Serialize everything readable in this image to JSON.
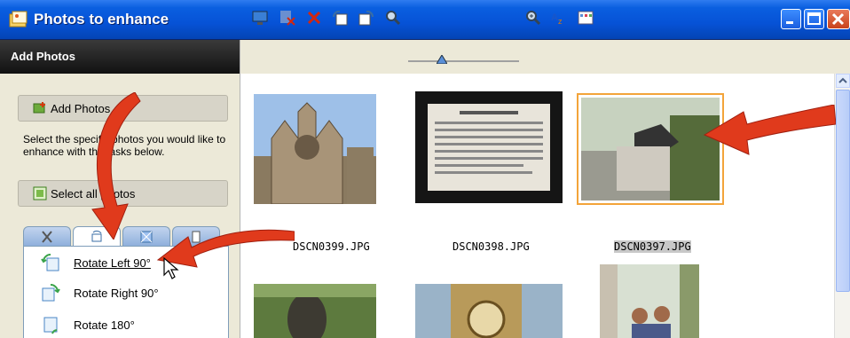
{
  "window": {
    "title": "Photos to enhance"
  },
  "sidebar": {
    "header": "Add Photos",
    "add_photos_label": "Add Photos",
    "description": "Select the specific photos you would like to enhance with the tasks below.",
    "select_all_label": "Select all photos",
    "tasks": [
      {
        "label": "Rotate Left 90°"
      },
      {
        "label": "Rotate Right 90°"
      },
      {
        "label": "Rotate 180°"
      }
    ]
  },
  "photos": [
    {
      "name": "DSCN0399.JPG",
      "selected": false
    },
    {
      "name": "DSCN0398.JPG",
      "selected": false
    },
    {
      "name": "DSCN0397.JPG",
      "selected": true
    }
  ],
  "colors": {
    "selection": "#f3a43a",
    "arrow": "#e03a1c",
    "titlebar": "#0652d6"
  }
}
